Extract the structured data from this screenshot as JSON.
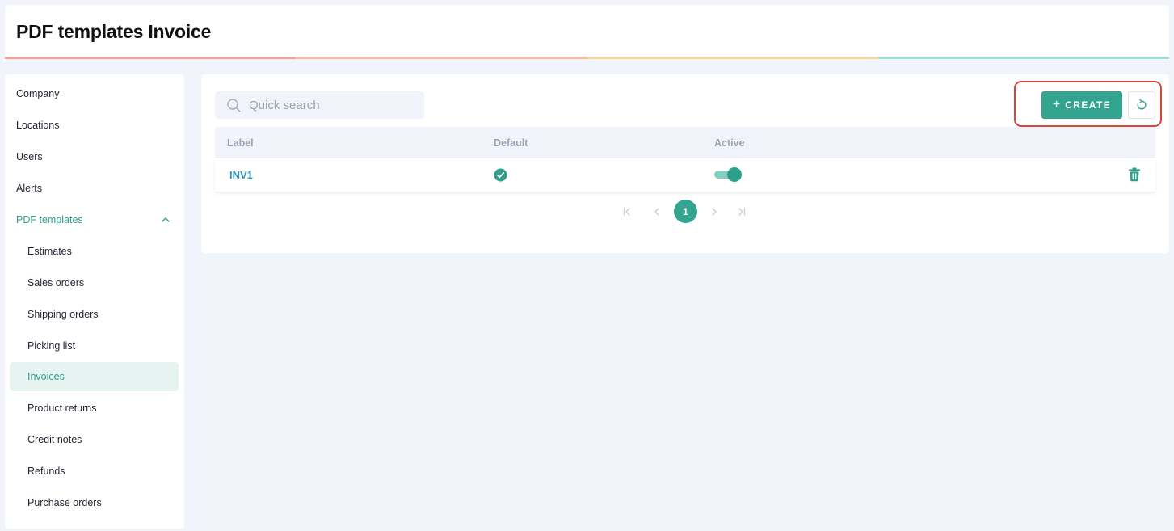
{
  "header": {
    "title": "PDF templates Invoice",
    "stripe_colors": [
      "#f3a495",
      "#f5bfa5",
      "#f3d8a2",
      "#a8ddd3"
    ]
  },
  "sidebar": {
    "items": [
      {
        "label": "Company"
      },
      {
        "label": "Locations"
      },
      {
        "label": "Users"
      },
      {
        "label": "Alerts"
      },
      {
        "label": "PDF templates",
        "expanded": true
      },
      {
        "label": "Estimates"
      },
      {
        "label": "Sales orders"
      },
      {
        "label": "Shipping orders"
      },
      {
        "label": "Picking list"
      },
      {
        "label": "Invoices",
        "active": true
      },
      {
        "label": "Product returns"
      },
      {
        "label": "Credit notes"
      },
      {
        "label": "Refunds"
      },
      {
        "label": "Purchase orders"
      }
    ]
  },
  "toolbar": {
    "search_placeholder": "Quick search",
    "create_label": "CREATE"
  },
  "table": {
    "columns": [
      "Label",
      "Default",
      "Active"
    ],
    "rows": [
      {
        "label": "INV1",
        "default": true,
        "active": true
      }
    ]
  },
  "pagination": {
    "current_page": "1"
  },
  "colors": {
    "accent": "#33a48f",
    "link": "#2e97b8",
    "highlight": "#d9463a"
  }
}
